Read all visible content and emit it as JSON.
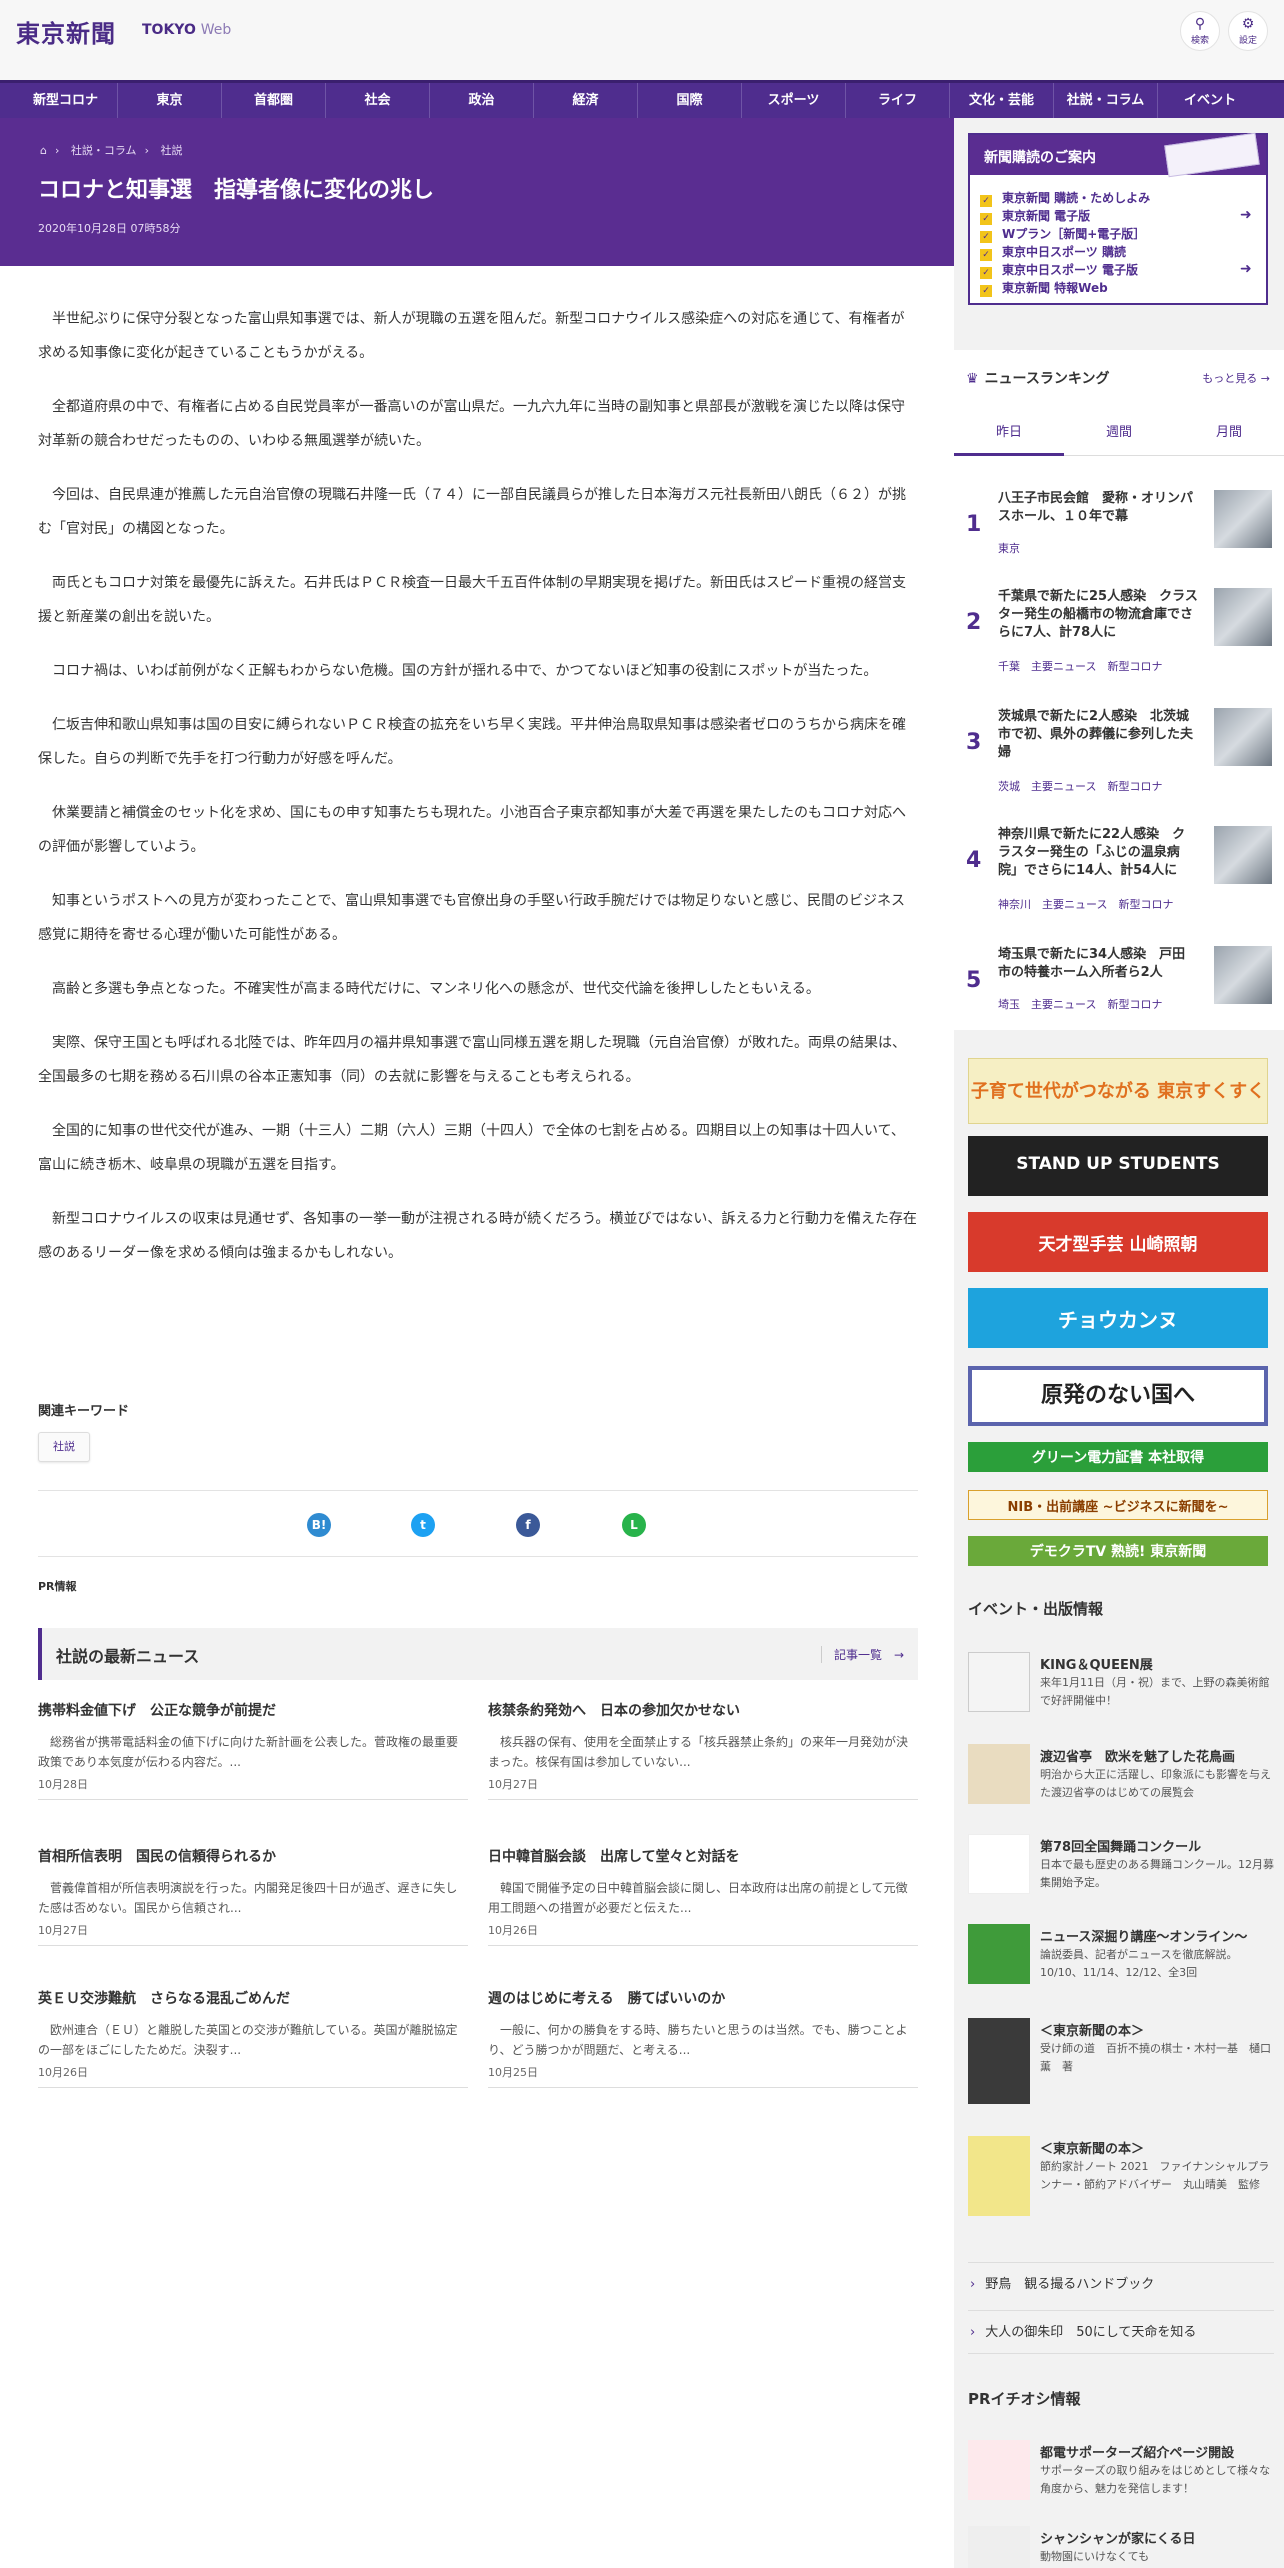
{
  "header": {
    "logo_jp": "東京新聞",
    "logo_en_1": "TOKYO",
    "logo_en_2": "Web",
    "search_label": "検索",
    "settings_label": "設定"
  },
  "nav": [
    "新型コロナ",
    "東京",
    "首都圏",
    "社会",
    "政治",
    "経済",
    "国際",
    "スポーツ",
    "ライフ",
    "文化・芸能",
    "社説・コラム",
    "イベント"
  ],
  "breadcrumb": [
    "社説・コラム",
    "社説"
  ],
  "article": {
    "title": "コロナと知事選　指導者像に変化の兆し",
    "date": "2020年10月28日 07時58分",
    "paragraphs": [
      "半世紀ぶりに保守分裂となった富山県知事選では、新人が現職の五選を阻んだ。新型コロナウイルス感染症への対応を通じて、有権者が求める知事像に変化が起きていることもうかがえる。",
      "全都道府県の中で、有権者に占める自民党員率が一番高いのが富山県だ。一九六九年に当時の副知事と県部長が激戦を演じた以降は保守対革新の競合わせだったものの、いわゆる無風選挙が続いた。",
      "今回は、自民県連が推薦した元自治官僚の現職石井隆一氏（７４）に一部自民議員らが推した日本海ガス元社長新田八朗氏（６２）が挑む「官対民」の構図となった。",
      "両氏ともコロナ対策を最優先に訴えた。石井氏はＰＣＲ検査一日最大千五百件体制の早期実現を掲げた。新田氏はスピード重視の経営支援と新産業の創出を説いた。",
      "コロナ禍は、いわば前例がなく正解もわからない危機。国の方針が揺れる中で、かつてないほど知事の役割にスポットが当たった。",
      "仁坂吉伸和歌山県知事は国の目安に縛られないＰＣＲ検査の拡充をいち早く実践。平井伸治鳥取県知事は感染者ゼロのうちから病床を確保した。自らの判断で先手を打つ行動力が好感を呼んだ。",
      "休業要請と補償金のセット化を求め、国にもの申す知事たちも現れた。小池百合子東京都知事が大差で再選を果たしたのもコロナ対応への評価が影響していよう。",
      "知事というポストへの見方が変わったことで、富山県知事選でも官僚出身の手堅い行政手腕だけでは物足りないと感じ、民間のビジネス感覚に期待を寄せる心理が働いた可能性がある。",
      "高齢と多選も争点となった。不確実性が高まる時代だけに、マンネリ化への懸念が、世代交代論を後押ししたともいえる。",
      "実際、保守王国とも呼ばれる北陸では、昨年四月の福井県知事選で富山同様五選を期した現職（元自治官僚）が敗れた。両県の結果は、全国最多の七期を務める石川県の谷本正憲知事（同）の去就に影響を与えることも考えられる。",
      "全国的に知事の世代交代が進み、一期（十三人）二期（六人）三期（十四人）で全体の七割を占める。四期目以上の知事は十四人いて、富山に続き栃木、岐阜県の現職が五選を目指す。",
      "新型コロナウイルスの収束は見通せず、各知事の一挙一動が注視される時が続くだろう。横並びではない、訴える力と行動力を備えた存在感のあるリーダー像を求める傾向は強まるかもしれない。"
    ]
  },
  "keywords": {
    "heading": "関連キーワード",
    "tags": [
      "社説"
    ]
  },
  "share": {
    "hatena": "B!",
    "twitter": "t",
    "facebook": "f",
    "line": "L"
  },
  "pr_label": "PR情報",
  "latest": {
    "heading": "社説の最新ニュース",
    "more": "記事一覧　→",
    "items": [
      {
        "title": "携帯料金値下げ　公正な競争が前提だ",
        "excerpt": "総務省が携帯電話料金の値下げに向けた新計画を公表した。菅政権の最重要政策であり本気度が伝わる内容だ。...",
        "date": "10月28日"
      },
      {
        "title": "核禁条約発効へ　日本の参加欠かせない",
        "excerpt": "核兵器の保有、使用を全面禁止する「核兵器禁止条約」の来年一月発効が決まった。核保有国は参加していない...",
        "date": "10月27日"
      },
      {
        "title": "首相所信表明　国民の信頼得られるか",
        "excerpt": "菅義偉首相が所信表明演説を行った。内閣発足後四十日が過ぎ、遅きに失した感は否めない。国民から信頼され...",
        "date": "10月27日"
      },
      {
        "title": "日中韓首脳会談　出席して堂々と対話を",
        "excerpt": "韓国で開催予定の日中韓首脳会談に関し、日本政府は出席の前提として元徴用工問題への措置が必要だと伝えた...",
        "date": "10月26日"
      },
      {
        "title": "英ＥＵ交渉難航　さらなる混乱ごめんだ",
        "excerpt": "欧州連合（ＥＵ）と離脱した英国との交渉が難航している。英国が離脱協定の一部をほごにしたためだ。決裂す...",
        "date": "10月26日"
      },
      {
        "title": "週のはじめに考える　勝てばいいのか",
        "excerpt": "一般に、何かの勝負をする時、勝ちたいと思うのは当然。でも、勝つことより、どう勝つかが問題だ、と考える...",
        "date": "10月25日"
      }
    ]
  },
  "subscribe": {
    "heading": "新聞購読のご案内",
    "items": [
      "東京新聞 購読・ためしよみ",
      "東京新聞 電子版",
      "Wプラン［新聞+電子版］",
      "東京中日スポーツ 購読",
      "東京中日スポーツ 電子版",
      "東京新聞 特報Web"
    ]
  },
  "ranking": {
    "heading": "ニュースランキング",
    "more": "もっと見る →",
    "tabs": [
      "昨日",
      "週間",
      "月間"
    ],
    "items": [
      {
        "rank": "1",
        "title": "八王子市民会館　愛称・オリンパスホール、１０年で幕",
        "tags": "東京"
      },
      {
        "rank": "2",
        "title": "千葉県で新たに25人感染　クラスター発生の船橋市の物流倉庫でさらに7人、計78人に",
        "tags": "千葉　主要ニュース　新型コロナ"
      },
      {
        "rank": "3",
        "title": "茨城県で新たに2人感染　北茨城市で初、県外の葬儀に参列した夫婦",
        "tags": "茨城　主要ニュース　新型コロナ"
      },
      {
        "rank": "4",
        "title": "神奈川県で新たに22人感染　クラスター発生の「ふじの温泉病院」でさらに14人、計54人に",
        "tags": "神奈川　主要ニュース　新型コロナ"
      },
      {
        "rank": "5",
        "title": "埼玉県で新たに34人感染　戸田市の特養ホーム入所者ら2人",
        "tags": "埼玉　主要ニュース　新型コロナ"
      }
    ]
  },
  "banners": [
    "子育て世代がつながる 東京すくすく",
    "STAND UP STUDENTS",
    "天才型手芸 山崎照朝",
    "チョウカンヌ",
    "原発のない国へ",
    "グリーン電力証書 本社取得",
    "NIB・出前講座 ~ビジネスに新聞を~",
    "デモクラTV 熟読! 東京新聞"
  ],
  "events": {
    "heading": "イベント・出版情報",
    "items": [
      {
        "title": "KING＆QUEEN展",
        "sub": "来年1月11日（月・祝）まで、上野の森美術館で好評開催中！"
      },
      {
        "title": "渡辺省亭　欧米を魅了した花鳥画",
        "sub": "明治から大正に活躍し、印象派にも影響を与えた渡辺省亭のはじめての展覧会"
      },
      {
        "title": "第78回全国舞踊コンクール",
        "sub": "日本で最も歴史のある舞踊コンクール。12月募集開始予定。"
      },
      {
        "title": "ニュース深掘り講座～オンライン～",
        "sub": "論説委員、記者がニュースを徹底解説。10/10、11/14、12/12、全3回"
      },
      {
        "title": "＜東京新聞の本＞",
        "sub": "受け師の道　百折不撓の棋士・木村一基　樋口薫　著"
      },
      {
        "title": "＜東京新聞の本＞",
        "sub": "節約家計ノート 2021　ファイナンシャルプランナー・節約アドバイザー　丸山晴美　監修"
      }
    ]
  },
  "links": [
    "野鳥　観る撮るハンドブック",
    "大人の御朱印　50にして天命を知る"
  ],
  "pr_pickup": {
    "heading": "PRイチオシ情報",
    "items": [
      {
        "title": "都電サポーターズ紹介ページ開設",
        "sub": "サポーターズの取り組みをはじめとして様々な角度から、魅力を発信します！"
      },
      {
        "title": "シャンシャンが家にくる日",
        "sub": "動物園にいけなくても"
      }
    ]
  },
  "colors": {
    "brand": "#4f2d8e",
    "hero": "#5a2d91",
    "accent_yellow": "#f2c41a"
  }
}
